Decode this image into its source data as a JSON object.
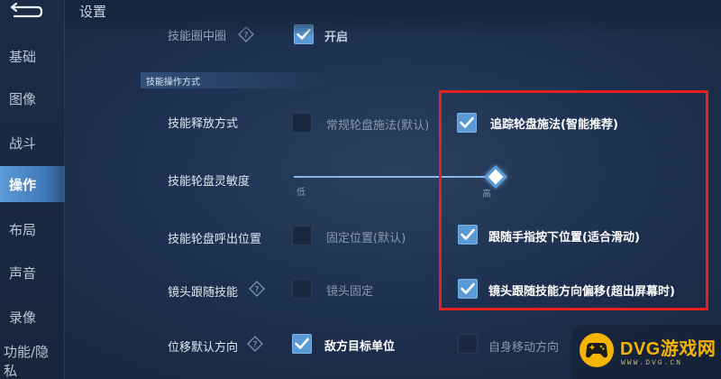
{
  "header": {
    "title": "设置"
  },
  "sidebar": {
    "items": [
      {
        "label": "基础"
      },
      {
        "label": "图像"
      },
      {
        "label": "战斗"
      },
      {
        "label": "操作"
      },
      {
        "label": "布局"
      },
      {
        "label": "声音"
      },
      {
        "label": "录像"
      },
      {
        "label": "功能/隐私"
      }
    ],
    "active_index": 3
  },
  "partial_row": {
    "label": "技能圈中圈",
    "option": "开启"
  },
  "section": {
    "title": "技能操作方式"
  },
  "settings": {
    "release_mode": {
      "label": "技能释放方式",
      "option_a": "常规轮盘施法(默认)",
      "option_b": "追踪轮盘施法(智能推荐)",
      "selected": "option_b"
    },
    "sensitivity": {
      "label": "技能轮盘灵敏度",
      "min_label": "低",
      "max_label": "高",
      "value": 1.0
    },
    "wheel_position": {
      "label": "技能轮盘呼出位置",
      "option_a": "固定位置(默认)",
      "option_b": "跟随手指按下位置(适合滑动)",
      "selected": "option_b"
    },
    "camera_follow": {
      "label": "镜头跟随技能",
      "option_a": "镜头固定",
      "option_b": "镜头跟随技能方向偏移(超出屏幕时)",
      "selected": "option_b"
    },
    "displacement_dir": {
      "label": "位移默认方向",
      "option_a": "敌方目标单位",
      "option_b": "自身移动方向",
      "selected": "option_a"
    }
  },
  "watermark": {
    "brand": "DVG游戏网",
    "url": "WWW.DVG.CN"
  },
  "colors": {
    "accent": "#5a9ad6",
    "highlight": "#e8201e",
    "watermark": "#f5b400"
  }
}
